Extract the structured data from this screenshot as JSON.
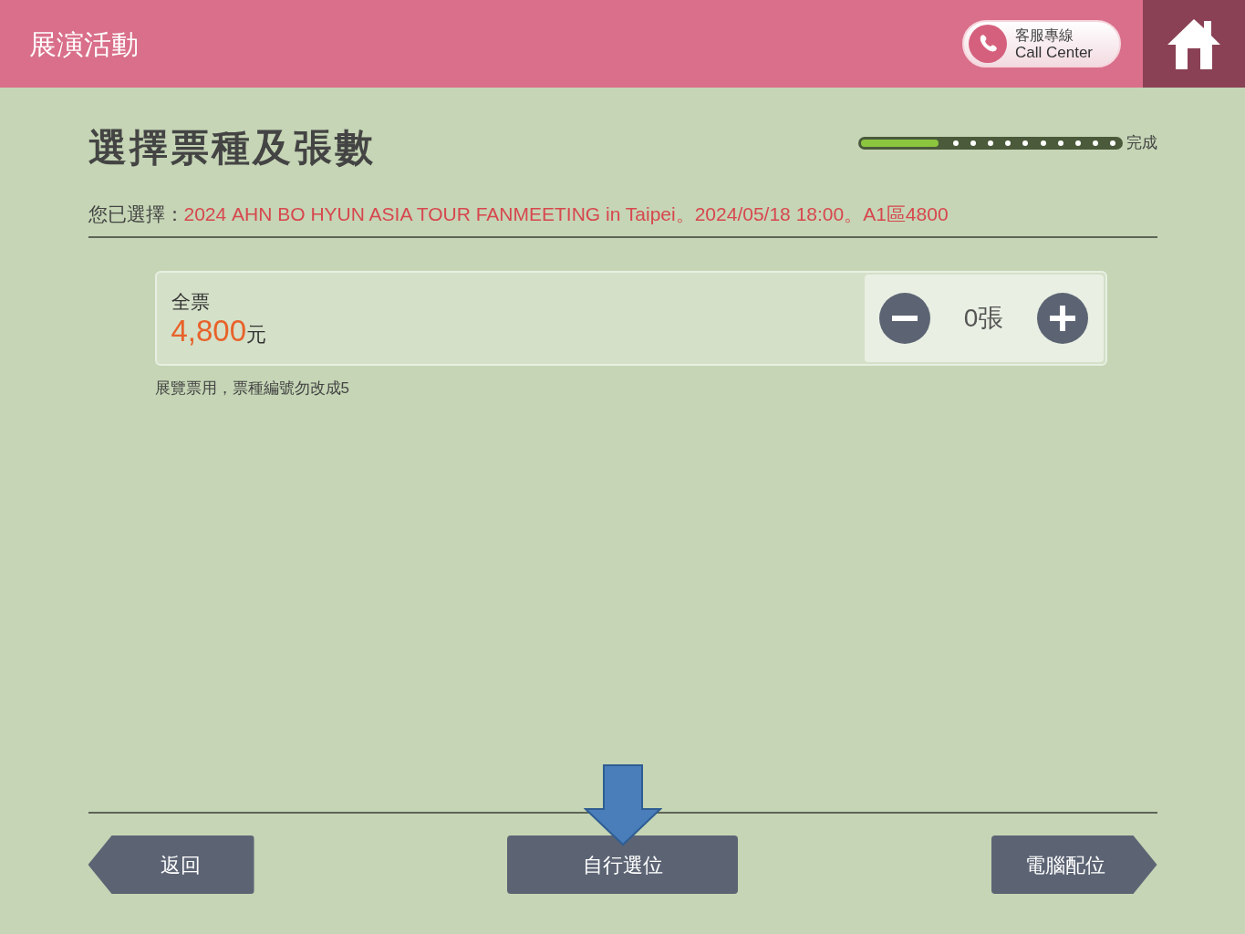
{
  "header": {
    "title": "展演活動",
    "call_center": {
      "label_zh": "客服專線",
      "label_en": "Call Center"
    }
  },
  "page_title": "選擇票種及張數",
  "progress": {
    "level": 0.3,
    "label": "完成"
  },
  "selection": {
    "label": "您已選擇：",
    "value": "2024 AHN BO HYUN ASIA TOUR FANMEETING in Taipei。2024/05/18 18:00。A1區4800"
  },
  "tickets": [
    {
      "name": "全票",
      "price": "4,800",
      "unit": "元",
      "quantity": "0張"
    }
  ],
  "note": "展覽票用，票種編號勿改成5",
  "buttons": [
    {
      "kind": "back",
      "label": "返回"
    },
    {
      "kind": "center",
      "label": "自行選位"
    },
    {
      "kind": "forward",
      "label": "電腦配位"
    }
  ]
}
